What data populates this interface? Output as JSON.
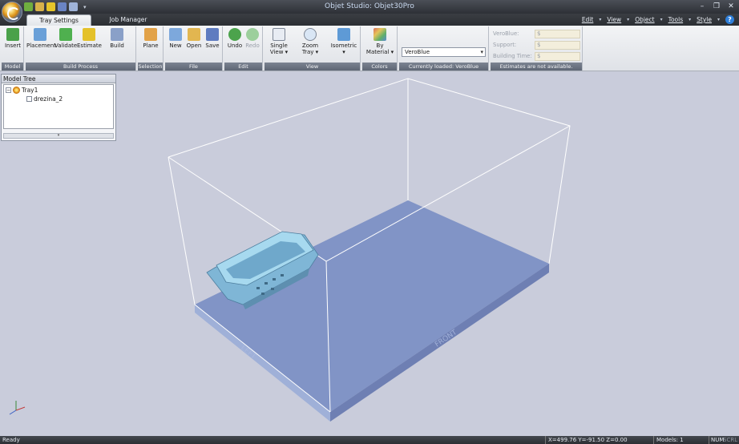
{
  "window": {
    "title": "Objet Studio: Objet30Pro"
  },
  "tabs": [
    {
      "label": "Tray Settings",
      "active": true
    },
    {
      "label": "Job Manager",
      "active": false
    }
  ],
  "menu": [
    "Edit",
    "View",
    "Object",
    "Tools",
    "Style"
  ],
  "ribbon": {
    "groups": {
      "model": "Model",
      "build_process": "Build Process",
      "selection": "Selection",
      "file": "File",
      "edit": "Edit",
      "view": "View",
      "colors": "Colors",
      "currently_loaded": "Currently loaded: VeroBlue",
      "estimates": "Estimates are not available."
    },
    "buttons": {
      "insert": "Insert",
      "placement": "Placement",
      "validate": "Validate",
      "estimate": "Estimate",
      "build": "Build",
      "plane": "Plane",
      "new": "New",
      "open": "Open",
      "save": "Save",
      "undo": "Undo",
      "redo": "Redo",
      "single_view_1": "Single",
      "single_view_2": "View ▾",
      "zoom_tray_1": "Zoom",
      "zoom_tray_2": "Tray ▾",
      "isometric_1": "Isometric",
      "isometric_2": "▾",
      "by_material_1": "By",
      "by_material_2": "Material ▾"
    },
    "material_select": "VeroBlue",
    "estimates_fields": [
      {
        "label": "VeroBlue:",
        "value": "$"
      },
      {
        "label": "Support:",
        "value": "$"
      },
      {
        "label": "Building Time:",
        "value": "$"
      }
    ]
  },
  "model_tree": {
    "title": "Model Tree",
    "tray": "Tray1",
    "item": "drezina_2"
  },
  "statusbar": {
    "ready": "Ready",
    "coords": "X=499.76 Y=-91.50 Z=0.00",
    "models": "Models: 1",
    "num": "NUM",
    "scrl": "SCRL"
  },
  "colors": {
    "tray": "#7f90c4",
    "model": "#8fc7e4",
    "background": "#c9ccdb",
    "ribbon_label": "#6a7280"
  }
}
